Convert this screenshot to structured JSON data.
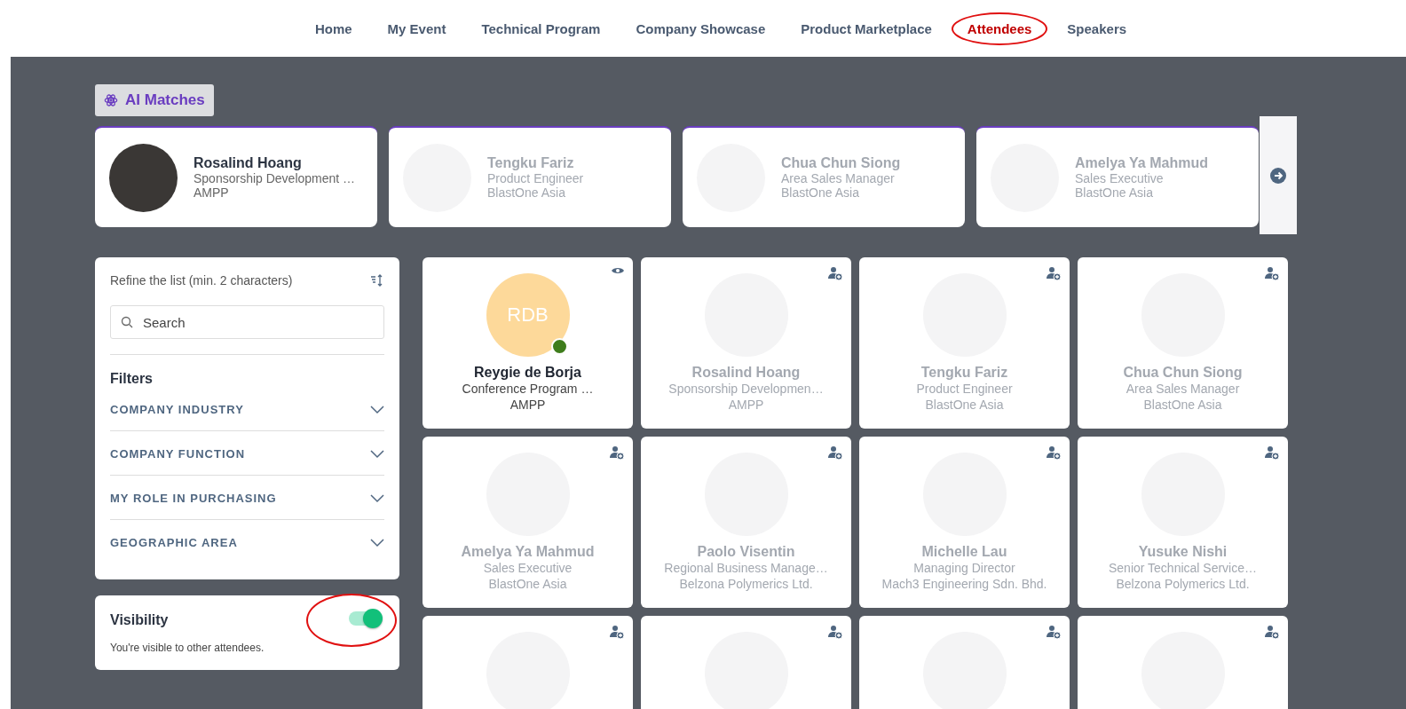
{
  "nav": [
    {
      "label": "Home",
      "selected": false,
      "circled": false
    },
    {
      "label": "My Event",
      "selected": false,
      "circled": false
    },
    {
      "label": "Technical Program",
      "selected": false,
      "circled": false
    },
    {
      "label": "Company Showcase",
      "selected": false,
      "circled": false
    },
    {
      "label": "Product Marketplace",
      "selected": false,
      "circled": false
    },
    {
      "label": "Attendees",
      "selected": true,
      "circled": true
    },
    {
      "label": "Speakers",
      "selected": false,
      "circled": false
    }
  ],
  "ai_matches": {
    "label": "AI Matches",
    "cards": [
      {
        "name": "Rosalind Hoang",
        "title": "Sponsorship Development …",
        "company": "AMPP",
        "faded": false
      },
      {
        "name": "Tengku Fariz",
        "title": "Product Engineer",
        "company": "BlastOne Asia",
        "faded": true
      },
      {
        "name": "Chua Chun Siong",
        "title": "Area Sales Manager",
        "company": "BlastOne Asia",
        "faded": true
      },
      {
        "name": "Amelya Ya Mahmud",
        "title": "Sales Executive",
        "company": "BlastOne Asia",
        "faded": true
      }
    ]
  },
  "refine": {
    "label": "Refine the list (min. 2 characters)",
    "search": {
      "placeholder": "Search"
    }
  },
  "filters": {
    "title": "Filters",
    "items": [
      {
        "label": "COMPANY INDUSTRY",
        "expanded": false
      },
      {
        "label": "COMPANY FUNCTION",
        "expanded": false
      },
      {
        "label": "MY ROLE IN PURCHASING",
        "expanded": false
      },
      {
        "label": "GEOGRAPHIC AREA",
        "expanded": false
      }
    ]
  },
  "visibility": {
    "title": "Visibility",
    "on": true,
    "circled": true,
    "text": "You're visible to other attendees."
  },
  "attendees": [
    {
      "kind": "self",
      "initials": "RDB",
      "online": true,
      "faded": false,
      "name": "Reygie de Borja",
      "title": "Conference Program …",
      "company": "AMPP"
    },
    {
      "kind": "contact",
      "faded": true,
      "name": "Rosalind Hoang",
      "title": "Sponsorship Developmen…",
      "company": "AMPP"
    },
    {
      "kind": "contact",
      "faded": true,
      "name": "Tengku Fariz",
      "title": "Product Engineer",
      "company": "BlastOne Asia"
    },
    {
      "kind": "contact",
      "faded": true,
      "name": "Chua Chun Siong",
      "title": "Area Sales Manager",
      "company": "BlastOne Asia"
    },
    {
      "kind": "contact",
      "faded": true,
      "name": "Amelya Ya Mahmud",
      "title": "Sales Executive",
      "company": "BlastOne Asia"
    },
    {
      "kind": "contact",
      "faded": true,
      "name": "Paolo Visentin",
      "title": "Regional Business Manage…",
      "company": "Belzona Polymerics Ltd."
    },
    {
      "kind": "contact",
      "faded": true,
      "name": "Michelle Lau",
      "title": "Managing Director",
      "company": "Mach3 Engineering Sdn. Bhd."
    },
    {
      "kind": "contact",
      "faded": true,
      "name": "Yusuke Nishi",
      "title": "Senior Technical Service…",
      "company": "Belzona Polymerics Ltd."
    },
    {
      "kind": "contact",
      "faded": true
    },
    {
      "kind": "contact",
      "faded": true
    },
    {
      "kind": "contact",
      "faded": true
    },
    {
      "kind": "contact",
      "faded": true
    }
  ]
}
